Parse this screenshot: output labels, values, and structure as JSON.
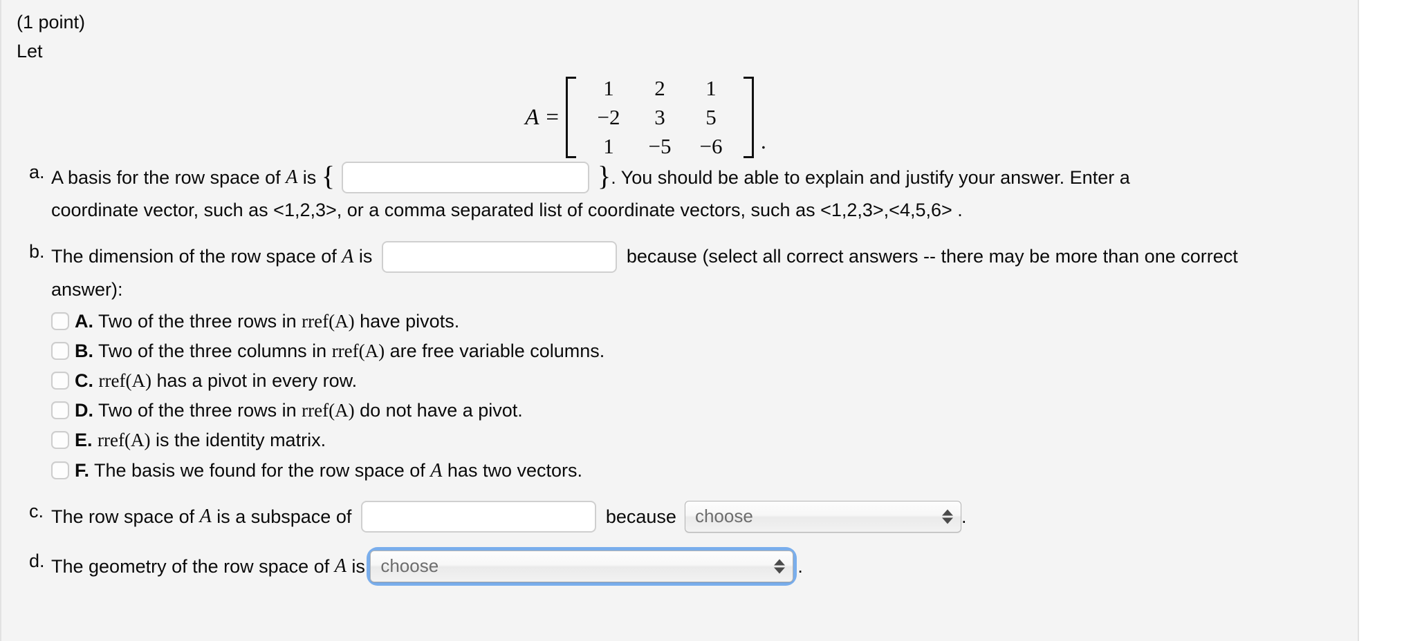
{
  "problem": {
    "points_label": "(1 point)",
    "let_label": "Let",
    "matrix": {
      "name": "A",
      "equals": "=",
      "rows": [
        [
          "1",
          "2",
          "1"
        ],
        [
          "−2",
          "3",
          "5"
        ],
        [
          "1",
          "−5",
          "−6"
        ]
      ],
      "trailing_punctuation": "."
    },
    "parts": [
      {
        "label": "a.",
        "text_before": "A basis for the row space of ",
        "var": "A",
        "text_after": " is ",
        "open_brace": "{",
        "close_brace": "}",
        "input_value": "",
        "input_placeholder": "",
        "text_tail": ". You should be able to explain and justify your answer. Enter a",
        "line2": "coordinate vector, such as <1,2,3>, or a comma separated list of coordinate vectors, such as <1,2,3>,<4,5,6> ."
      },
      {
        "label": "b.",
        "text_before": "The dimension of the row space of ",
        "var": "A",
        "text_after": " is ",
        "input_value": "",
        "input_placeholder": "",
        "text_tail": "because (select all correct answers -- there may be more than one correct",
        "line2": "answer):",
        "options": [
          {
            "letter": "A.",
            "text_prefix": " Two of the three rows in ",
            "func": "rref(A)",
            "text_suffix": " have pivots.",
            "checked": false
          },
          {
            "letter": "B.",
            "text_prefix": " Two of the three columns in ",
            "func": "rref(A)",
            "text_suffix": " are free variable columns.",
            "checked": false
          },
          {
            "letter": "C.",
            "text_prefix": " ",
            "func": "rref(A)",
            "text_suffix": " has a pivot in every row.",
            "checked": false
          },
          {
            "letter": "D.",
            "text_prefix": " Two of the three rows in ",
            "func": "rref(A)",
            "text_suffix": " do not have a pivot.",
            "checked": false
          },
          {
            "letter": "E.",
            "text_prefix": " ",
            "func": "rref(A)",
            "text_suffix": " is the identity matrix.",
            "checked": false
          },
          {
            "letter": "F.",
            "text_prefix": " The basis we found for the row space of ",
            "func": "A",
            "text_suffix": " has two vectors.",
            "checked": false
          }
        ]
      },
      {
        "label": "c.",
        "text_before": "The row space of ",
        "var": "A",
        "text_after": " is a subspace of ",
        "input_value": "",
        "input_placeholder": "",
        "because_label": "because",
        "select_value": "choose",
        "trailing_punctuation": "."
      },
      {
        "label": "d.",
        "text_before": "The geometry of the row space of ",
        "var": "A",
        "text_after": " is ",
        "select_value": "choose",
        "select_focused": true,
        "trailing_punctuation": "."
      }
    ]
  },
  "colors": {
    "page_background": "#f4f4f4",
    "outside_background": "#ffffff",
    "text": "#0a0a0a",
    "input_border": "#cfcfcf",
    "select_placeholder_text": "#6d6d6d",
    "focus_ring": "#7aaeec",
    "pane_border": "#e2e2e2"
  }
}
